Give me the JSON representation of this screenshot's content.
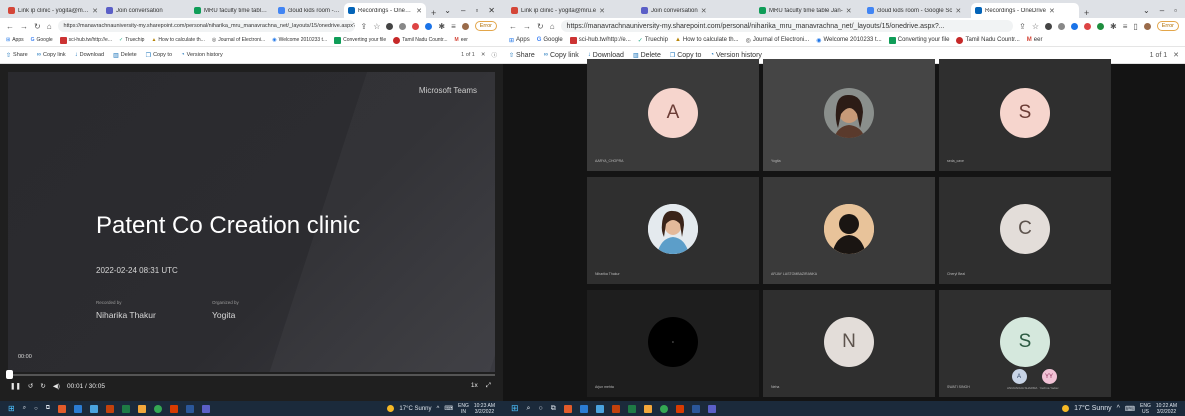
{
  "left": {
    "tabs": [
      {
        "label": "Link ip clinic - yogita@mru.e",
        "icon": "gmail-icon",
        "color": "#d44638"
      },
      {
        "label": "Join conversation",
        "icon": "teams-icon",
        "color": "#5b5fc7"
      },
      {
        "label": "MRU faculty time table Jan-",
        "icon": "sheets-icon",
        "color": "#0f9d58"
      },
      {
        "label": "cloud kids room - Google Sc",
        "icon": "google-icon",
        "color": "#4285f4"
      },
      {
        "label": "Recordings - OneDrive",
        "icon": "onedrive-icon",
        "color": "#0364b8",
        "active": true
      }
    ],
    "url": "https://manavrachnauniversity-my.sharepoint.com/personal/niharika_mru_manavrachna_net/_layouts/15/onedrive.aspx?",
    "error_label": "Error",
    "bookmarks": [
      "Apps",
      "Google",
      "sci-hub.tw/http://e...",
      "Truechip",
      "How to calculate th...",
      "Journal of Electroni...",
      "Welcome 2010233 t...",
      "Converting your file",
      "Tamil Nadu Countr...",
      "eer"
    ],
    "toolbar": {
      "share": "Share",
      "copy_link": "Copy link",
      "download": "Download",
      "delete": "Delete",
      "copy_to": "Copy to",
      "version_history": "Version history"
    },
    "pager": "1 of 1",
    "slide": {
      "brand": "Microsoft Teams",
      "title": "Patent Co Creation clinic",
      "datetime": "2022-02-24 08:31 UTC",
      "recorded_by_label": "Recorded by",
      "recorded_by": "Niharika Thakur",
      "organized_by_label": "Organized by",
      "organized_by": "Yogita"
    },
    "player": {
      "overlay_time": "00:00",
      "time": "00:01 / 30:05",
      "speed": "1x",
      "progress": 0.001
    },
    "taskbar": {
      "weather": "17°C Sunny",
      "lang": "ENG",
      "region": "IN",
      "time": "10:23 AM",
      "date": "3/2/2022"
    }
  },
  "right": {
    "tabs": [
      {
        "label": "Link ip clinic - yogita@mru.e",
        "icon": "gmail-icon",
        "color": "#d44638"
      },
      {
        "label": "Join conversation",
        "icon": "teams-icon",
        "color": "#5b5fc7"
      },
      {
        "label": "MRU faculty time table Jan-",
        "icon": "sheets-icon",
        "color": "#0f9d58"
      },
      {
        "label": "cloud kids room - Google Sc",
        "icon": "google-icon",
        "color": "#4285f4"
      },
      {
        "label": "Recordings - OneDrive",
        "icon": "onedrive-icon",
        "color": "#0364b8",
        "active": true
      }
    ],
    "url": "https://manavrachnauniversity-my.sharepoint.com/personal/niharika_mru_manavrachna_net/_layouts/15/onedrive.aspx?...",
    "error_label": "Error",
    "bookmarks": [
      "Apps",
      "Google",
      "sci-hub.tw/http://e...",
      "Truechip",
      "How to calculate th...",
      "Journal of Electroni...",
      "Welcome 2010233 t...",
      "Converting your file",
      "Tamil Nadu Countr...",
      "eer"
    ],
    "toolbar": {
      "share": "Share",
      "copy_link": "Copy link",
      "download": "Download",
      "delete": "Delete",
      "copy_to": "Copy to",
      "version_history": "Version history"
    },
    "pager": "1 of 1",
    "participants": [
      {
        "initial": "A",
        "name": "AARYA_CHOPRA",
        "kind": "letter",
        "color": "#f6d5cd"
      },
      {
        "initial": "",
        "name": "Yogita",
        "kind": "photo-woman"
      },
      {
        "initial": "S",
        "name": "seda_cave",
        "kind": "letter",
        "color": "#f6d5cd"
      },
      {
        "initial": "",
        "name": "Niharika Thakur",
        "kind": "photo-woman2"
      },
      {
        "initial": "",
        "name": "ARJAY LASTOMBAZIRANKA",
        "kind": "photo-silhouette"
      },
      {
        "initial": "C",
        "name": "Cheryl Beal",
        "kind": "letter",
        "color": "#f6d5cd"
      },
      {
        "initial": "",
        "name": "Arjun mehta",
        "kind": "black"
      },
      {
        "initial": "N",
        "name": "Neha",
        "kind": "letter",
        "color": "#e3ddd9"
      },
      {
        "initial": "S",
        "name": "SWATI SINGH",
        "kind": "letter",
        "color": "#d5e8dd"
      }
    ],
    "overflow": [
      {
        "initial": "A",
        "name": "ANURADHA SHARMA",
        "color": "#c8d4e6"
      },
      {
        "initial": "YY",
        "name": "Yachna Yadav",
        "color": "#f2c2d6"
      }
    ],
    "taskbar": {
      "weather": "17°C Sunny",
      "lang": "ENG",
      "region": "US",
      "time": "10:22 AM",
      "date": "3/2/2022"
    }
  }
}
